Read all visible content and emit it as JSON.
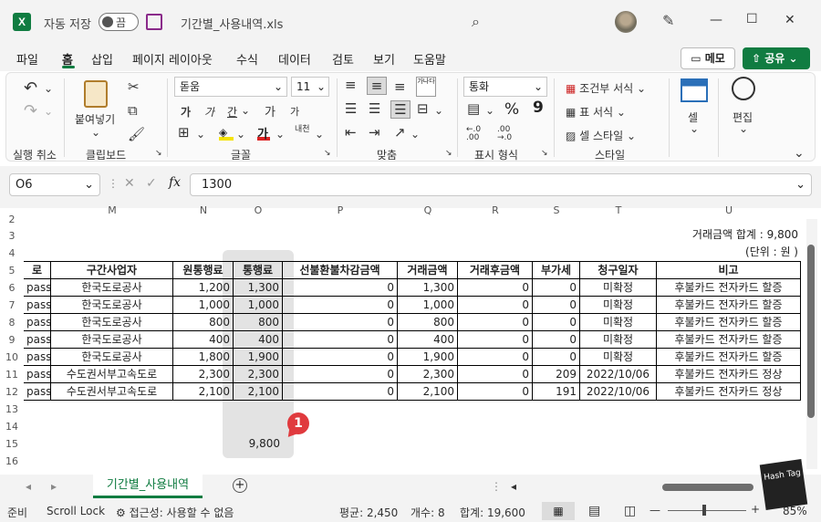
{
  "titlebar": {
    "autosave_label": "자동 저장",
    "autosave_state": "끔",
    "file_name": "기간별_사용내역.xls",
    "save_icon": "save-icon",
    "search_icon": "search-icon",
    "minimize": "—",
    "maximize": "☐",
    "close": "✕"
  },
  "ribbon_tabs": [
    "파일",
    "홈",
    "삽입",
    "페이지 레이아웃",
    "수식",
    "데이터",
    "검토",
    "보기",
    "도움말"
  ],
  "active_tab": "홈",
  "memo_label": "메모",
  "share_label": "공유",
  "ribbon": {
    "undo_group": "실행 취소",
    "clipboard_group": "클립보드",
    "paste_label": "붙여넣기",
    "font_group": "글꼴",
    "font_name": "돋움",
    "font_size": "11",
    "bold": "가",
    "italic": "가",
    "underline": "간",
    "grow": "가",
    "shrink": "가",
    "phonetic": "내천",
    "align_group": "맞춤",
    "wrap_label": "가나다",
    "number_group": "표시 형식",
    "number_format": "통화",
    "percent": "%",
    "comma": "9",
    "styles_group": "스타일",
    "cond_format": "조건부 서식",
    "format_table": "표 서식",
    "cell_style": "셀 스타일",
    "cells_label": "셀",
    "edit_label": "편집",
    "accent_color": "#107c41"
  },
  "formula_bar": {
    "name_box": "O6",
    "fx": "fx",
    "value": "1300"
  },
  "columns": [
    "M",
    "N",
    "O",
    "P",
    "Q",
    "R",
    "S",
    "T",
    "U"
  ],
  "rows": [
    "2",
    "3",
    "4",
    "5",
    "6",
    "7",
    "8",
    "9",
    "10",
    "11",
    "12",
    "13",
    "14",
    "15",
    "16"
  ],
  "sheet": {
    "row3_note": "거래금액 합계 : 9,800",
    "row4_note": "(단위 : 원 )",
    "headers": [
      "로",
      "구간사업자",
      "원통행료",
      "통행료",
      "선불환불차감금액",
      "거래금액",
      "거래후금액",
      "부가세",
      "청구일자",
      "비고"
    ],
    "data": [
      [
        "pass",
        "한국도로공사",
        "1,200",
        "1,300",
        "0",
        "1,300",
        "0",
        "0",
        "미확정",
        "후불카드 전자카드 할증"
      ],
      [
        "pass",
        "한국도로공사",
        "1,000",
        "1,000",
        "0",
        "1,000",
        "0",
        "0",
        "미확정",
        "후불카드 전자카드 할증"
      ],
      [
        "pass",
        "한국도로공사",
        "800",
        "800",
        "0",
        "800",
        "0",
        "0",
        "미확정",
        "후불카드 전자카드 할증"
      ],
      [
        "pass",
        "한국도로공사",
        "400",
        "400",
        "0",
        "400",
        "0",
        "0",
        "미확정",
        "후불카드 전자카드 할증"
      ],
      [
        "pass",
        "한국도로공사",
        "1,800",
        "1,900",
        "0",
        "1,900",
        "0",
        "0",
        "미확정",
        "후불카드 전자카드 할증"
      ],
      [
        "pass",
        "수도권서부고속도로",
        "2,300",
        "2,300",
        "0",
        "2,300",
        "0",
        "209",
        "2022/10/06",
        "후불카드 전자카드 정상"
      ],
      [
        "pass",
        "수도권서부고속도로",
        "2,100",
        "2,100",
        "0",
        "2,100",
        "0",
        "191",
        "2022/10/06",
        "후불카드 전자카드 정상"
      ]
    ],
    "sum_value": "9,800",
    "callout": "1"
  },
  "sheet_tab": "기간별_사용내역",
  "add_sheet": "+",
  "status": {
    "ready": "준비",
    "scroll_lock": "Scroll Lock",
    "accessibility": "접근성: 사용할 수 없음",
    "average": "평균: 2,450",
    "count": "개수: 8",
    "sum": "합계: 19,600",
    "zoom": "85%"
  },
  "watermark": "Hash Tag"
}
